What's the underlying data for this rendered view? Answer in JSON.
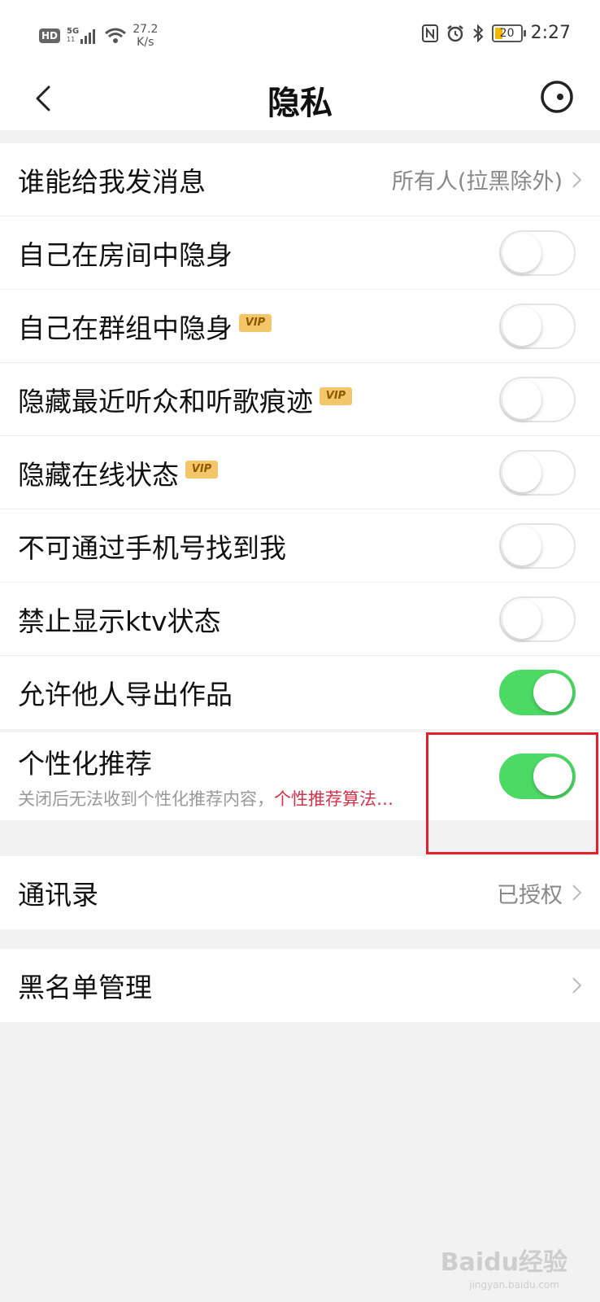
{
  "status_bar": {
    "hd": "HD",
    "network": "5G",
    "network_sub": "11",
    "speed_value": "27.2",
    "speed_unit": "K/s",
    "battery": "20",
    "time": "2:27"
  },
  "header": {
    "title": "隐私"
  },
  "section1": {
    "message_row": {
      "label": "谁能给我发消息",
      "value": "所有人(拉黑除外)"
    },
    "toggles": [
      {
        "label": "自己在房间中隐身",
        "vip": false,
        "on": false
      },
      {
        "label": "自己在群组中隐身",
        "vip": true,
        "on": false
      },
      {
        "label": "隐藏最近听众和听歌痕迹",
        "vip": true,
        "on": false
      },
      {
        "label": "隐藏在线状态",
        "vip": true,
        "on": false
      },
      {
        "label": "不可通过手机号找到我",
        "vip": false,
        "on": false
      },
      {
        "label": "禁止显示ktv状态",
        "vip": false,
        "on": false
      },
      {
        "label": "允许他人导出作品",
        "vip": false,
        "on": true
      }
    ],
    "vip_badge": "VIP"
  },
  "section2": {
    "label": "个性化推荐",
    "subtitle": "关闭后无法收到个性化推荐内容，",
    "link": "个性推荐算法…",
    "on": true
  },
  "section3": {
    "label": "通讯录",
    "value": "已授权"
  },
  "section4": {
    "label": "黑名单管理"
  },
  "watermark": {
    "brand": "Baidu经验",
    "url": "jingyan.baidu.com"
  },
  "colors": {
    "toggle_on": "#4cd964",
    "link_red": "#d6304a",
    "highlight_red": "#e3202e",
    "vip_gold": "#f3c66a"
  }
}
